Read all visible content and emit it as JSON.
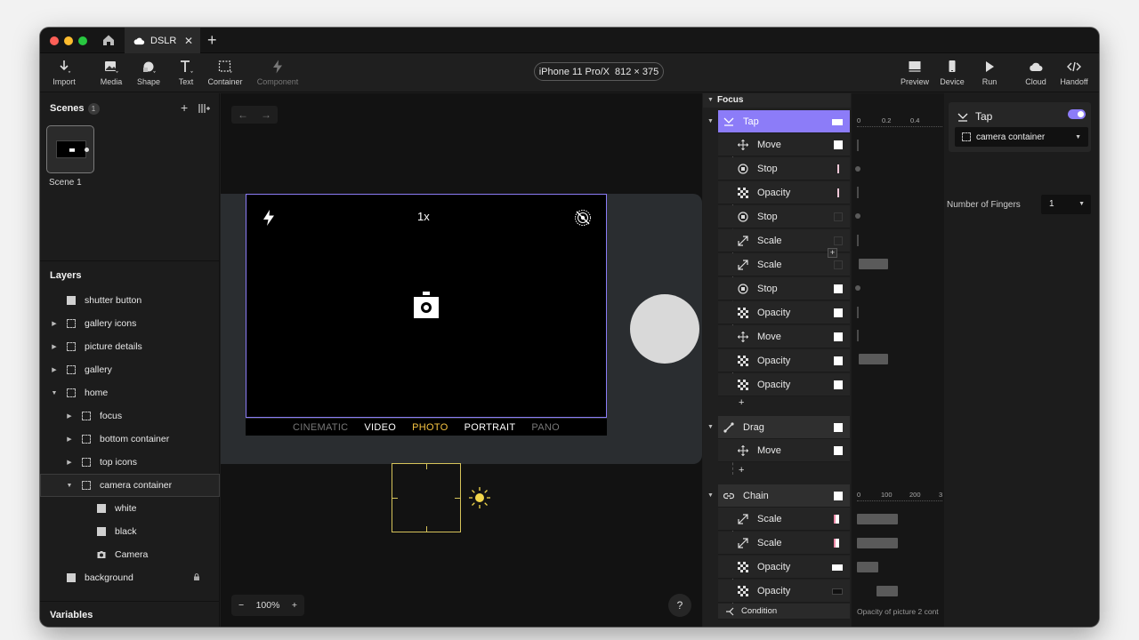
{
  "tab": {
    "title": "DSLR",
    "close": "✕",
    "add": "+"
  },
  "toolbar": {
    "left": [
      {
        "label": "Import"
      },
      {
        "label": "Media"
      },
      {
        "label": "Shape"
      },
      {
        "label": "Text"
      },
      {
        "label": "Container"
      },
      {
        "label": "Component"
      }
    ],
    "device": {
      "name": "iPhone 11 Pro/X",
      "size": "812 × 375"
    },
    "right": [
      {
        "label": "Preview"
      },
      {
        "label": "Device"
      },
      {
        "label": "Run"
      },
      {
        "label": "Cloud"
      },
      {
        "label": "Handoff"
      }
    ]
  },
  "scenes": {
    "title": "Scenes",
    "count": "1",
    "add": "+",
    "items": [
      {
        "label": "Scene 1"
      }
    ]
  },
  "layers": {
    "title": "Layers",
    "items": [
      {
        "label": "shutter button"
      },
      {
        "label": "gallery icons"
      },
      {
        "label": "picture details"
      },
      {
        "label": "gallery"
      },
      {
        "label": "home"
      },
      {
        "label": "focus"
      },
      {
        "label": "bottom container"
      },
      {
        "label": "top icons"
      },
      {
        "label": "camera container"
      },
      {
        "label": "white"
      },
      {
        "label": "black"
      },
      {
        "label": "Camera"
      },
      {
        "label": "background"
      }
    ]
  },
  "variables": {
    "title": "Variables"
  },
  "canvas": {
    "zoom_indicator": "1x",
    "modes": [
      "CINEMATIC",
      "VIDEO",
      "PHOTO",
      "PORTRAIT",
      "PANO"
    ],
    "zoom_level": "100%",
    "zoom_minus": "−",
    "zoom_plus": "+",
    "help": "?",
    "nav_back": "←",
    "nav_forward": "→"
  },
  "interactions": {
    "head": "Focus",
    "tap_label": "Tap",
    "tap_actions": [
      "Move",
      "Stop",
      "Opacity",
      "Stop",
      "Scale",
      "Scale",
      "Stop",
      "Opacity",
      "Move",
      "Opacity",
      "Opacity"
    ],
    "drag_label": "Drag",
    "drag_actions": [
      "Move"
    ],
    "chain_label": "Chain",
    "chain_actions": [
      "Scale",
      "Scale",
      "Opacity",
      "Opacity"
    ],
    "condition_label": "Condition",
    "plus": "+"
  },
  "timeline": {
    "ruler1": [
      "0",
      "0.2",
      "0.4"
    ],
    "ruler2": [
      "0",
      "100",
      "200",
      "3"
    ],
    "caption": "Opacity of picture 2 cont"
  },
  "properties": {
    "title": "Tap",
    "target": "camera container",
    "fingers_label": "Number of Fingers",
    "fingers_value": "1"
  },
  "colors": {
    "accent": "#8c7cf8",
    "photo_mode": "#f5c342",
    "focus_box": "#d6c35a"
  }
}
